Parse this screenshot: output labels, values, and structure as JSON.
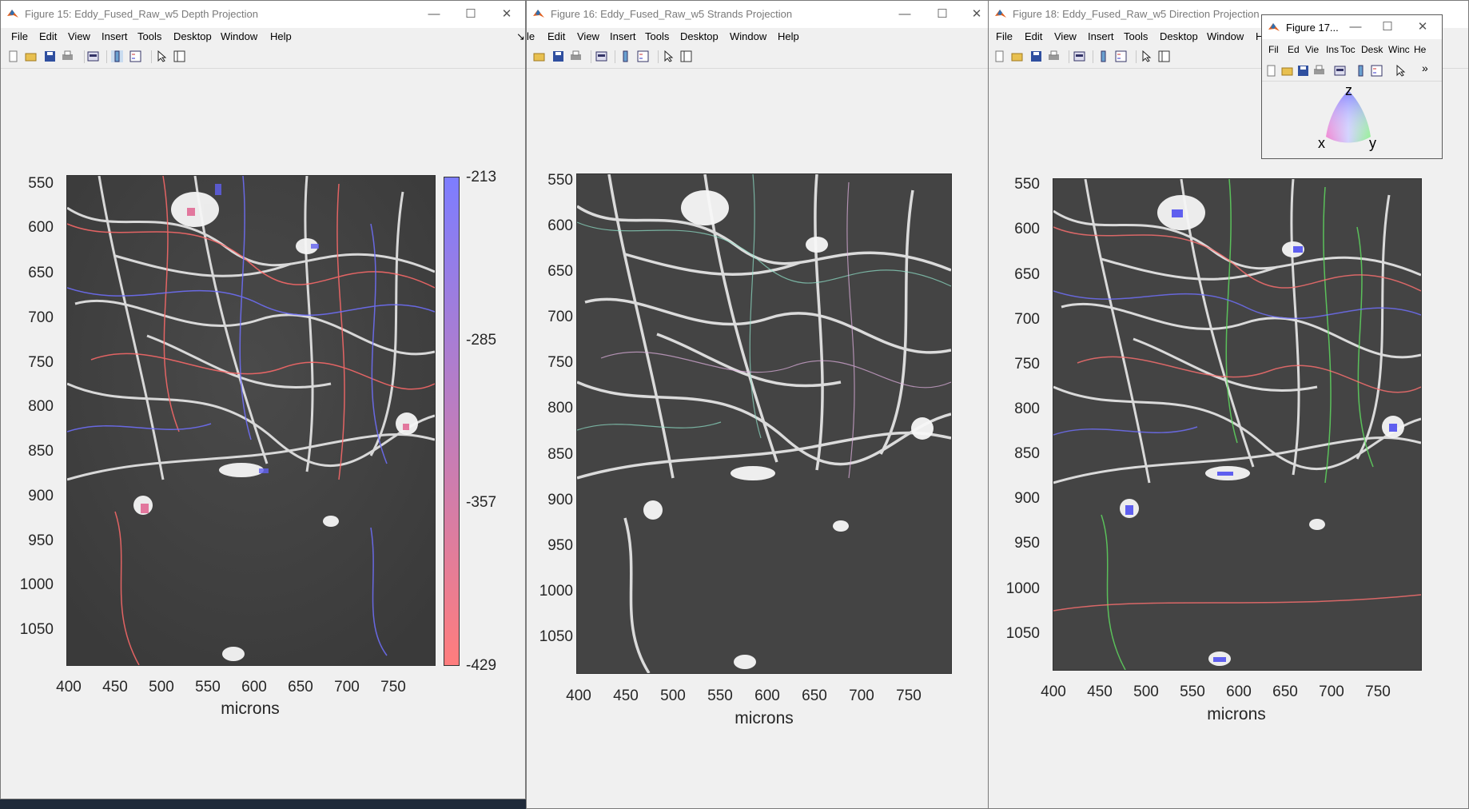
{
  "windows": {
    "fig15": {
      "title": "Figure 15: Eddy_Fused_Raw_w5 Depth Projection",
      "menu": [
        "File",
        "Edit",
        "View",
        "Insert",
        "Tools",
        "Desktop",
        "Window",
        "Help"
      ],
      "yticks": [
        "550",
        "600",
        "650",
        "700",
        "750",
        "800",
        "850",
        "900",
        "950",
        "1000",
        "1050"
      ],
      "xticks": [
        "400",
        "450",
        "500",
        "550",
        "600",
        "650",
        "700",
        "750"
      ],
      "xlabel": "microns",
      "colorbar_ticks": [
        "-213",
        "-285",
        "-357",
        "-429"
      ],
      "colorbar_top": "#7d7dff",
      "colorbar_bottom": "#ff7d7d"
    },
    "fig16": {
      "title": "Figure 16: Eddy_Fused_Raw_w5 Strands Projection",
      "menu": [
        "le",
        "Edit",
        "View",
        "Insert",
        "Tools",
        "Desktop",
        "Window",
        "Help"
      ],
      "yticks": [
        "550",
        "600",
        "650",
        "700",
        "750",
        "800",
        "850",
        "900",
        "950",
        "1000",
        "1050"
      ],
      "xticks": [
        "400",
        "450",
        "500",
        "550",
        "600",
        "650",
        "700",
        "750"
      ],
      "xlabel": "microns"
    },
    "fig18": {
      "title": "Figure 18: Eddy_Fused_Raw_w5 Direction Projection",
      "menu": [
        "File",
        "Edit",
        "View",
        "Insert",
        "Tools",
        "Desktop",
        "Window",
        "He"
      ],
      "yticks": [
        "550",
        "600",
        "650",
        "700",
        "750",
        "800",
        "850",
        "900",
        "950",
        "1000",
        "1050"
      ],
      "xticks": [
        "400",
        "450",
        "500",
        "550",
        "600",
        "650",
        "700",
        "750"
      ],
      "xlabel": "microns"
    },
    "fig17": {
      "title": "Figure 17...",
      "menu": [
        "Fil",
        "Ed",
        "Vie",
        "Ins",
        "Toc",
        "Desk",
        "Winc",
        "He"
      ],
      "axis_labels": {
        "x": "x",
        "y": "y",
        "z": "z"
      }
    }
  },
  "icons": [
    "new-file-icon",
    "open-folder-icon",
    "save-icon",
    "print-icon",
    "print-preview-icon",
    "colorbar-icon",
    "legend-icon",
    "pointer-icon",
    "property-editor-icon",
    "minimize-icon",
    "maximize-icon",
    "close-icon",
    "matlab-logo-icon"
  ]
}
